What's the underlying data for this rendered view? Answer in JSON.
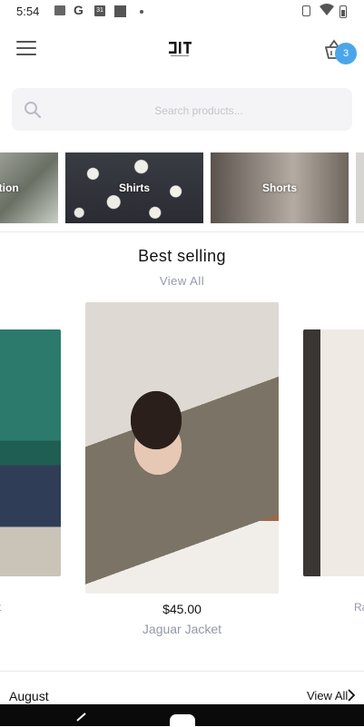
{
  "status_bar": {
    "time": "5:54",
    "icons": [
      "image-icon",
      "google-icon",
      "calendar-icon",
      "square-icon",
      "dot-icon",
      "vibrate-icon",
      "wifi-icon",
      "battery-icon"
    ],
    "calendar_day": "31"
  },
  "header": {
    "menu_icon": "hamburger-icon",
    "cart_icon": "basket-icon",
    "cart_count": "3"
  },
  "search": {
    "placeholder": "Search products...",
    "value": ""
  },
  "categories": [
    {
      "label": "ction"
    },
    {
      "label": "Shirts"
    },
    {
      "label": "Shorts"
    },
    {
      "label": ""
    }
  ],
  "best_selling": {
    "title": "Best selling",
    "view_all": "View All",
    "left_partial_name": "t",
    "right_partial_name": "Ra",
    "featured": {
      "price": "$45.00",
      "name": "Jaguar Jacket"
    }
  },
  "august": {
    "title": "August",
    "view_all": "View All"
  },
  "colors": {
    "accent": "#4aa6ea",
    "muted_text": "#9497aa",
    "search_bg": "#f4f4f6"
  }
}
